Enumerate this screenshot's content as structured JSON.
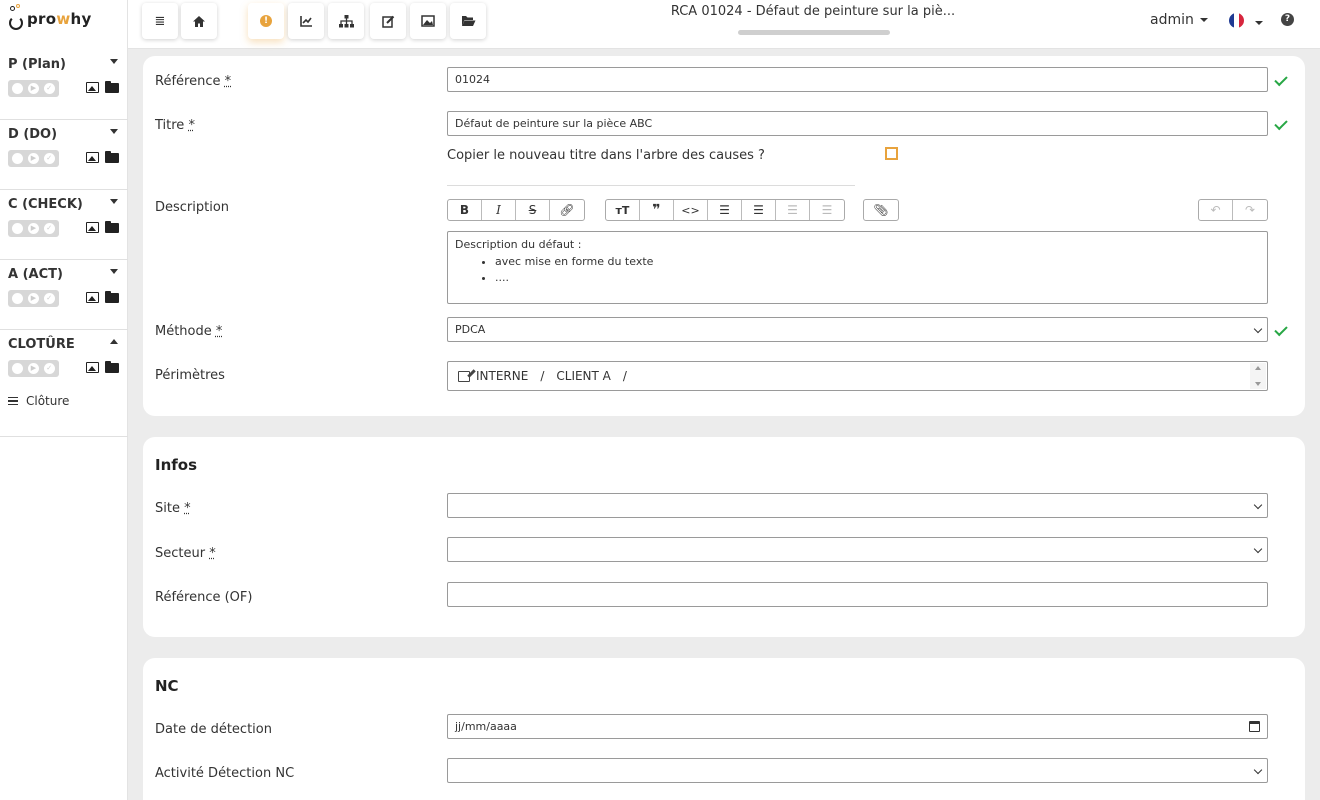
{
  "app": {
    "logo_text_1": "pro",
    "logo_text_2": "w",
    "logo_text_3": "hy"
  },
  "sidebar": {
    "phases": [
      {
        "title": "P (Plan)"
      },
      {
        "title": "D (DO)"
      },
      {
        "title": "C (CHECK)"
      },
      {
        "title": "A (ACT)"
      },
      {
        "title": "CLOTÛRE"
      }
    ],
    "cloture_item": "Clôture"
  },
  "topbar": {
    "page_title": "RCA 01024 - Défaut de peinture sur la piè...",
    "user": "admin",
    "help": "?",
    "tools": [
      "menu-icon",
      "home-icon",
      "alert-icon",
      "chart-icon",
      "sitemap-icon",
      "edit-icon",
      "image-icon",
      "folder-open-icon"
    ]
  },
  "main_card": {
    "reference_label": "Référence",
    "reference_value": "01024",
    "titre_label": "Titre",
    "titre_value": "Défaut de peinture sur la pièce ABC",
    "copy_label": "Copier le nouveau titre dans l'arbre des causes ?",
    "description_label": "Description",
    "description_heading": "Description du défaut :",
    "description_items": [
      "avec mise en forme du texte",
      "...."
    ],
    "methode_label": "Méthode",
    "methode_value": "PDCA",
    "perimetres_label": "Périmètres",
    "perimetres": [
      "INTERNE",
      "CLIENT A"
    ],
    "separator": "/"
  },
  "infos_card": {
    "title": "Infos",
    "site_label": "Site",
    "secteur_label": "Secteur",
    "ref_of_label": "Référence (OF)"
  },
  "nc_card": {
    "title": "NC",
    "date_label": "Date de détection",
    "date_placeholder": "jj/mm/aaaa",
    "activite_label": "Activité Détection NC"
  },
  "required_mark": "*",
  "colors": {
    "accent": "#e8a33d",
    "valid": "#28a745",
    "background": "#ececec"
  }
}
